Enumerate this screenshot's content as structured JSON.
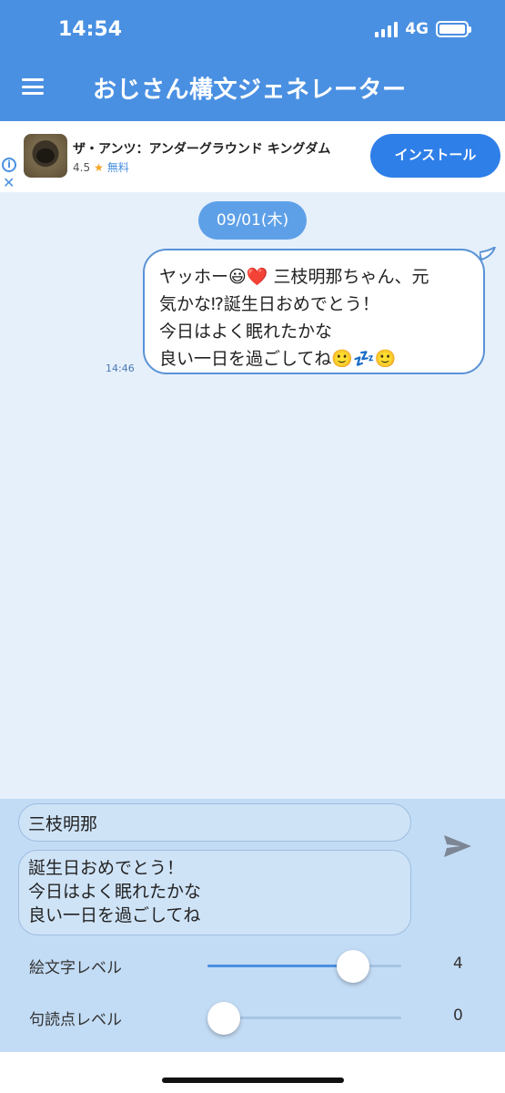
{
  "status_bar": {
    "time": "14:54",
    "network": "4G"
  },
  "app_bar": {
    "title": "おじさん構文ジェネレーター",
    "menu_icon": "menu-icon"
  },
  "ad": {
    "title": "ザ・アンツ：アンダーグラウンド キングダム",
    "rating": "4.5",
    "star": "★",
    "price": "無料",
    "install_label": "インストール",
    "info_icon": "info-icon",
    "close_icon": "close-icon"
  },
  "chat": {
    "date": "09/01(木)",
    "message": {
      "lines": [
        "ヤッホー😃❤️ 三枝明那ちゃん、元",
        "気かな⁉誕生日おめでとう！",
        "今日はよく眠れたかな",
        "良い一日を過ごしてね🙂💤🙂"
      ],
      "time": "14:46"
    }
  },
  "composer": {
    "name_value": "三枝明那",
    "message_lines": [
      "誕生日おめでとう！",
      "今日はよく眠れたかな",
      "良い一日を過ごしてね"
    ],
    "send_icon": "send-icon",
    "sliders": [
      {
        "label": "絵文字レベル",
        "value": "4",
        "fraction": 0.75
      },
      {
        "label": "句読点レベル",
        "value": "0",
        "fraction": 0.0
      }
    ]
  },
  "colors": {
    "primary": "#4a90e2",
    "install": "#2f7fe8",
    "composer_bg": "#c3dcf5",
    "chat_bg": "#e6f0fb"
  }
}
